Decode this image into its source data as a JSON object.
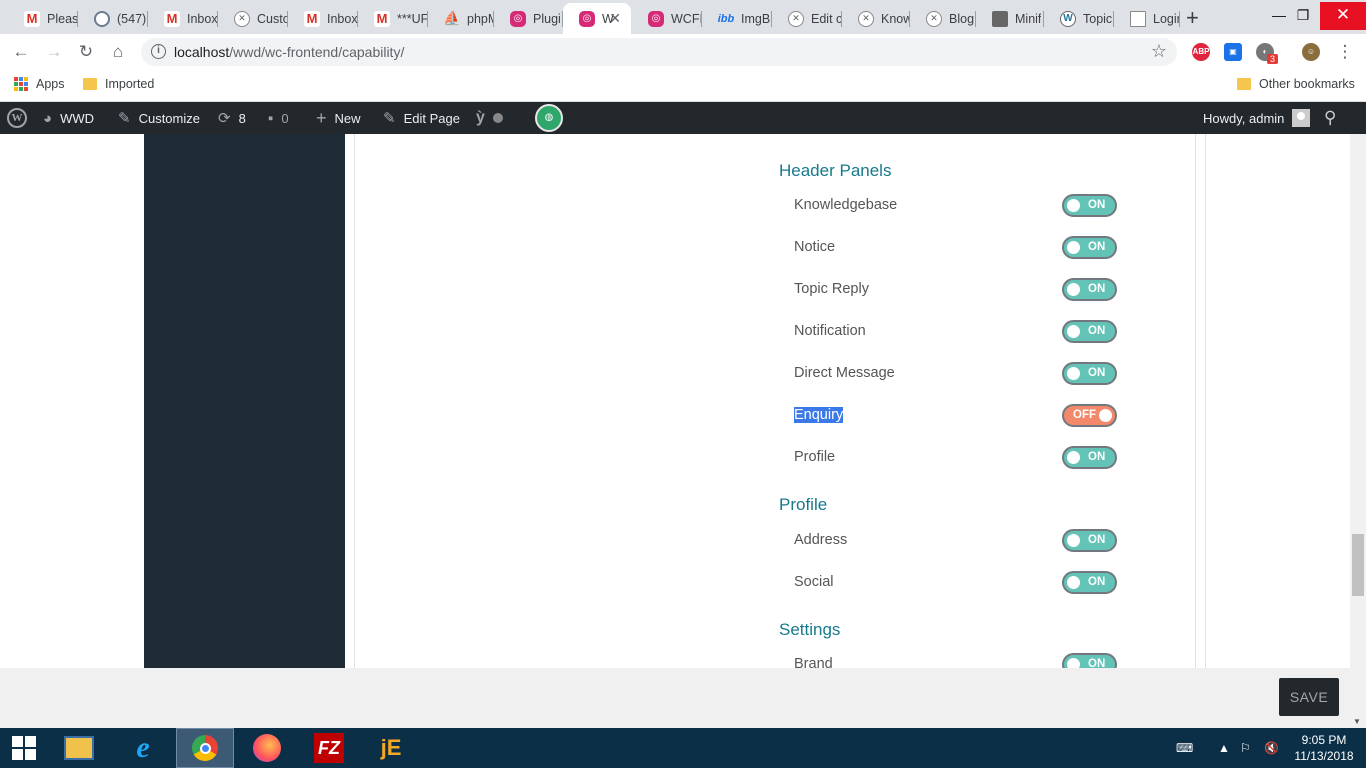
{
  "browser": {
    "tabs": [
      {
        "label": "Pleas",
        "icon": "gmail-icon",
        "glyph": "M"
      },
      {
        "label": "(547)",
        "icon": "ring-icon",
        "glyph": "◎"
      },
      {
        "label": "Inbox",
        "icon": "gmail-icon",
        "glyph": "M"
      },
      {
        "label": "Custo",
        "icon": "site-icon",
        "glyph": "✕"
      },
      {
        "label": "Inbox",
        "icon": "gmail-icon",
        "glyph": "M"
      },
      {
        "label": "***UF",
        "icon": "gmail-icon",
        "glyph": "M"
      },
      {
        "label": "phpM",
        "icon": "phpmyadmin-icon",
        "glyph": "⛵"
      },
      {
        "label": "Plugi",
        "icon": "plugin-icon",
        "glyph": "◎"
      },
      {
        "label": "W",
        "icon": "plugin-icon",
        "glyph": "◎",
        "active": true
      },
      {
        "label": "WCFI",
        "icon": "plugin-icon",
        "glyph": "◎"
      },
      {
        "label": "ImgB",
        "icon": "imgbb-icon",
        "glyph": "ibb"
      },
      {
        "label": "Edit c",
        "icon": "site-icon",
        "glyph": "✕"
      },
      {
        "label": "Know",
        "icon": "site-icon",
        "glyph": "✕"
      },
      {
        "label": "Blog",
        "icon": "site-icon",
        "glyph": "✕"
      },
      {
        "label": "Minif",
        "icon": "minify-icon",
        "glyph": ""
      },
      {
        "label": "Topic",
        "icon": "wordpress-icon",
        "glyph": "W"
      },
      {
        "label": "Login",
        "icon": "document-icon",
        "glyph": ""
      }
    ],
    "url_host": "localhost",
    "url_path": "/wwd/wc-frontend/capability/",
    "bookmarks": {
      "apps": "Apps",
      "imported": "Imported",
      "other": "Other bookmarks"
    },
    "ext_badge": "3"
  },
  "adminbar": {
    "site": "WWD",
    "customize": "Customize",
    "updates": "8",
    "comments": "0",
    "new": "New",
    "edit_page": "Edit Page",
    "howdy": "Howdy, admin"
  },
  "sections": [
    {
      "title": "Header Panels",
      "options": [
        {
          "label": "Knowledgebase",
          "state": "ON"
        },
        {
          "label": "Notice",
          "state": "ON"
        },
        {
          "label": "Topic Reply",
          "state": "ON"
        },
        {
          "label": "Notification",
          "state": "ON"
        },
        {
          "label": "Direct Message",
          "state": "ON"
        },
        {
          "label": "Enquiry",
          "state": "OFF",
          "selected": true
        },
        {
          "label": "Profile",
          "state": "ON"
        }
      ]
    },
    {
      "title": "Profile",
      "options": [
        {
          "label": "Address",
          "state": "ON"
        },
        {
          "label": "Social",
          "state": "ON"
        }
      ]
    },
    {
      "title": "Settings",
      "options": [
        {
          "label": "Brand",
          "state": "ON"
        }
      ]
    }
  ],
  "footer": {
    "save": "SAVE"
  },
  "taskbar": {
    "time": "9:05 PM",
    "date": "11/13/2018"
  },
  "colors": {
    "accent": "#177a8b",
    "toggle_on": "#62c3b6",
    "toggle_off": "#f1896a",
    "adminbar": "#23282d",
    "sidebar": "#1f2b35"
  }
}
